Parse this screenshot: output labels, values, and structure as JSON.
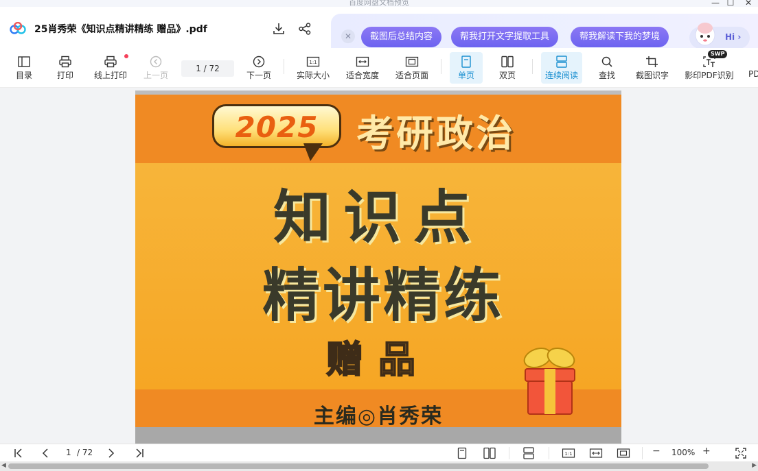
{
  "window": {
    "app_title": "百度网盘文档预览",
    "minimize": "—",
    "maximize": "☐",
    "close": "✕"
  },
  "header": {
    "doc_title": "25肖秀荣《知识点精讲精练 赠品》.pdf",
    "ai_chips": [
      "截图后总结内容",
      "帮我打开文字提取工具",
      "帮我解读下我的梦境"
    ],
    "ai_close": "✕",
    "hi_label": "Hi ›"
  },
  "toolbar": {
    "items": [
      {
        "key": "toc",
        "label": "目录"
      },
      {
        "key": "print",
        "label": "打印"
      },
      {
        "key": "online_print",
        "label": "线上打印"
      },
      {
        "key": "prev",
        "label": "上一页"
      },
      {
        "key": "next",
        "label": "下一页"
      },
      {
        "key": "actual",
        "label": "实际大小"
      },
      {
        "key": "fit_width",
        "label": "适合宽度"
      },
      {
        "key": "fit_page",
        "label": "适合页面"
      },
      {
        "key": "single",
        "label": "单页"
      },
      {
        "key": "double",
        "label": "双页"
      },
      {
        "key": "continuous",
        "label": "连续阅读"
      },
      {
        "key": "find",
        "label": "查找"
      },
      {
        "key": "ocr",
        "label": "截图识字"
      },
      {
        "key": "scan_pdf",
        "label": "影印PDF识别"
      },
      {
        "key": "more",
        "label": "PD"
      }
    ],
    "page_input": "1  / 72",
    "swp_badge": "SWP",
    "actual_icon_text": "1:1"
  },
  "document": {
    "year": "2025",
    "exam_title": "考研政治",
    "main_line1": "知识点",
    "main_line2": "精讲精练",
    "gift_label": "赠品",
    "editor": "主编◎肖秀荣"
  },
  "statusbar": {
    "page_current": "1",
    "page_total": "/ 72",
    "zoom": "100%",
    "zoom_minus": "−",
    "zoom_plus": "+",
    "actual_icon_text": "1:1"
  },
  "colors": {
    "accent": "#1a8fd0",
    "ai_chip": "#7367f0",
    "cover_orange": "#f29a1a"
  }
}
